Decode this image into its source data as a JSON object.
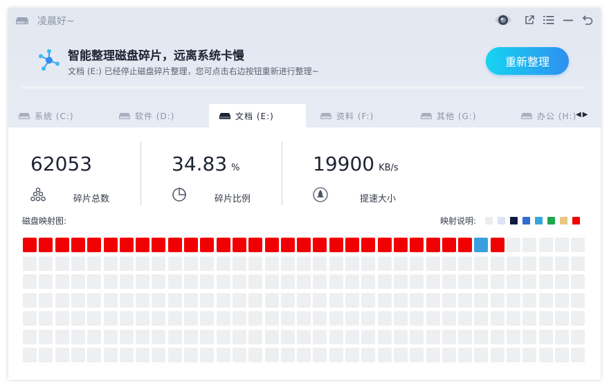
{
  "app": {
    "greeting": "凌晨好~"
  },
  "banner": {
    "title": "智能整理磁盘碎片，远离系统卡慢",
    "subtitle": "文档 (E:) 已经停止磁盘碎片整理，您可点击右边按钮重新进行整理~",
    "button": "重新整理"
  },
  "tabs": [
    {
      "label": "系统 (C:)",
      "active": false
    },
    {
      "label": "软件 (D:)",
      "active": false
    },
    {
      "label": "文档 (E:)",
      "active": true
    },
    {
      "label": "资料 (F:)",
      "active": false
    },
    {
      "label": "其他 (G:)",
      "active": false
    },
    {
      "label": "办公 (H:)",
      "active": false
    }
  ],
  "stats": {
    "fragments": {
      "value": "62053",
      "label": "碎片总数"
    },
    "ratio": {
      "value": "34.83",
      "unit": "%",
      "label": "碎片比例"
    },
    "speed": {
      "value": "19900",
      "unit": "KB/s",
      "label": "提速大小"
    }
  },
  "disk_map": {
    "title": "磁盘映射图:",
    "legend_label": "映射说明:",
    "legend_colors": [
      "#ececee",
      "#dde3f3",
      "#0f1b3d",
      "#2f6bd0",
      "#38a6de",
      "#1ea650",
      "#e8c583",
      "#f00000"
    ],
    "columns": 35,
    "rows": 7,
    "cells": [
      "red",
      "red",
      "red",
      "red",
      "red",
      "red",
      "red",
      "red",
      "red",
      "red",
      "red",
      "red",
      "red",
      "red",
      "red",
      "red",
      "red",
      "red",
      "red",
      "red",
      "red",
      "red",
      "red",
      "red",
      "red",
      "red",
      "red",
      "red",
      "blue",
      "red"
    ],
    "cell_colors": {
      "red": "#f00000",
      "blue": "#3aa0dd",
      "empty": "#eeeff1"
    }
  }
}
